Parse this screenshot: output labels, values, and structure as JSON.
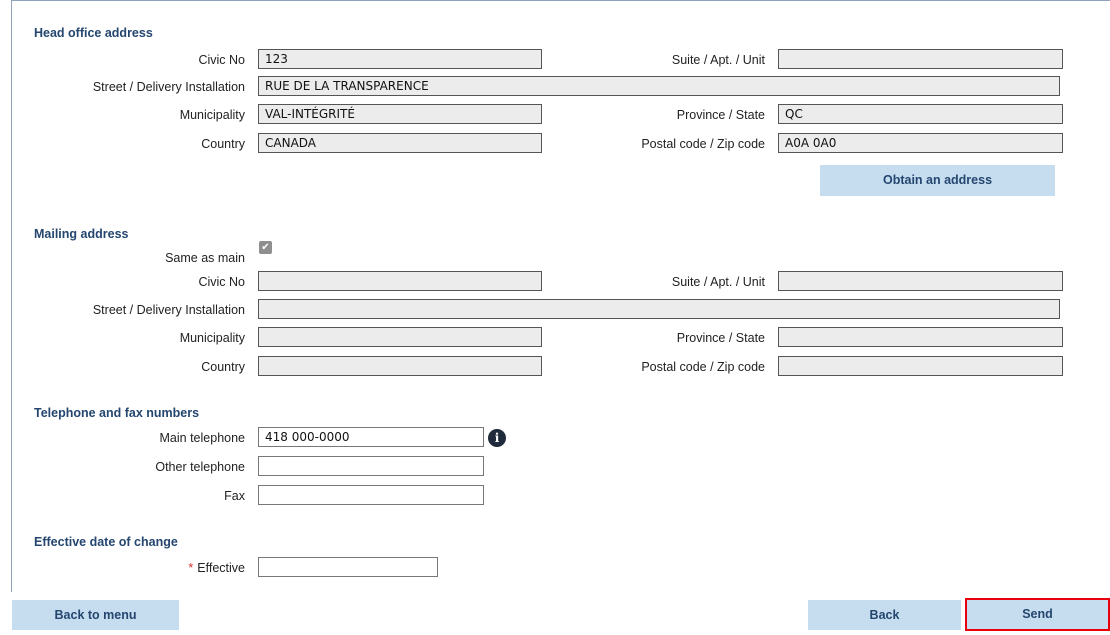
{
  "head_office": {
    "title": "Head office address",
    "civic_label": "Civic No",
    "civic_value": "123",
    "suite_label": "Suite / Apt. / Unit",
    "suite_value": "",
    "street_label": "Street / Delivery Installation",
    "street_value": "RUE DE LA TRANSPARENCE",
    "municipality_label": "Municipality",
    "municipality_value": "VAL-INTÉGRITÉ",
    "province_label": "Province / State",
    "province_value": "QC",
    "country_label": "Country",
    "country_value": "CANADA",
    "postal_label": "Postal code / Zip code",
    "postal_value": "A0A 0A0",
    "obtain_button": "Obtain an address"
  },
  "mailing": {
    "title": "Mailing address",
    "same_label": "Same as main",
    "same_checked": true,
    "civic_label": "Civic No",
    "suite_label": "Suite / Apt. / Unit",
    "street_label": "Street / Delivery Installation",
    "municipality_label": "Municipality",
    "province_label": "Province / State",
    "country_label": "Country",
    "postal_label": "Postal code / Zip code"
  },
  "phones": {
    "title": "Telephone and fax numbers",
    "main_label": "Main telephone",
    "main_value": "418 000-0000",
    "other_label": "Other telephone",
    "other_value": "",
    "fax_label": "Fax",
    "fax_value": ""
  },
  "effective": {
    "title": "Effective date of change",
    "required_mark": "*",
    "label": "Effective",
    "value": ""
  },
  "footer": {
    "back_to_menu": "Back to menu",
    "back": "Back",
    "send": "Send"
  },
  "icons": {
    "checkbox": "checkmark-icon",
    "info": "info-icon"
  },
  "colors": {
    "accent": "#24466f",
    "button_bg": "#c6dcef",
    "highlight": "#e8000d",
    "readonly_bg": "#ececec"
  }
}
